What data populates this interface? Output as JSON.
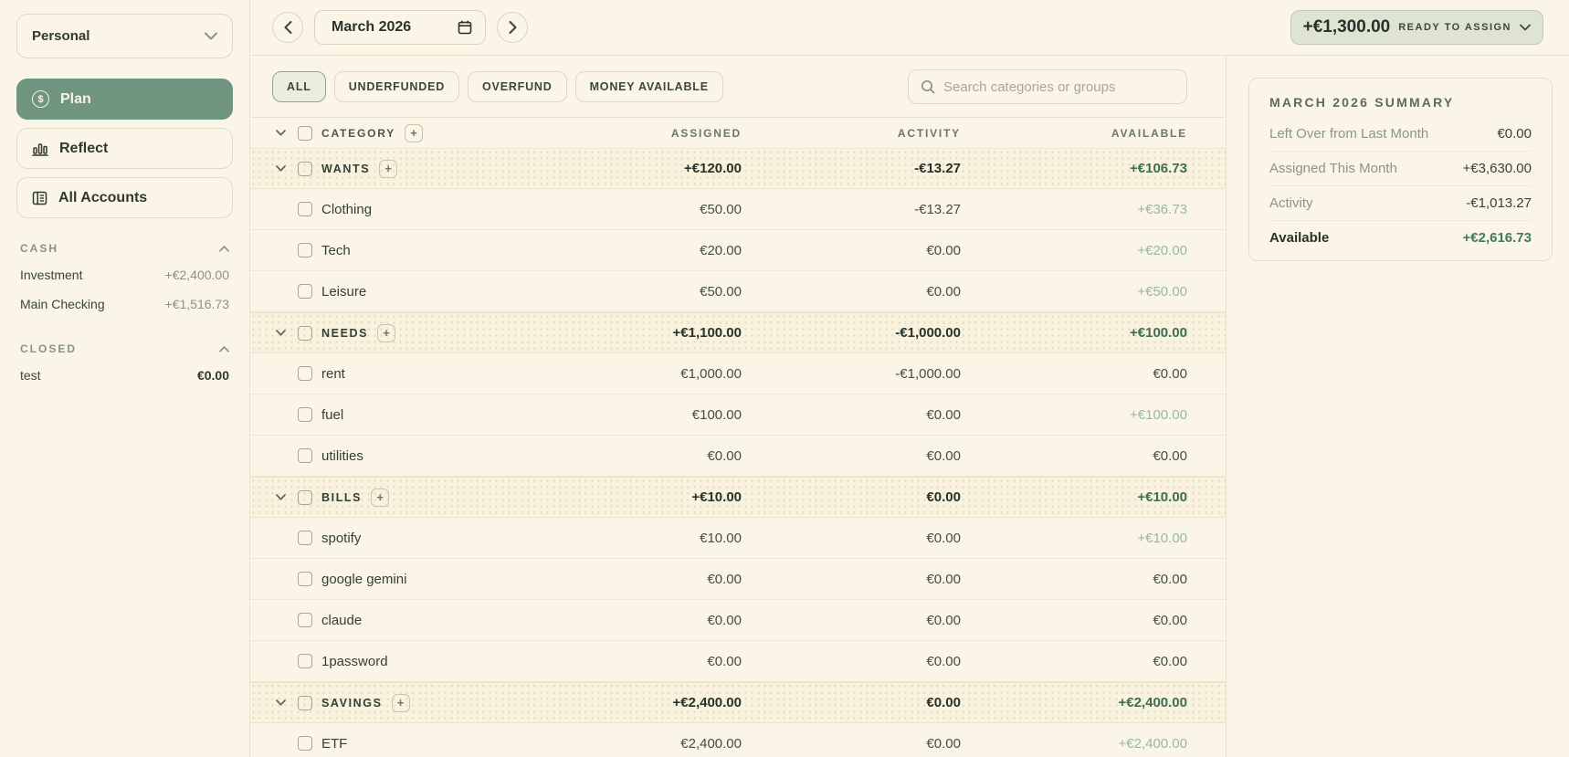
{
  "sidebar": {
    "budget_name": "Personal",
    "nav": [
      {
        "label": "Plan",
        "icon": "dollar-circle-icon",
        "active": true
      },
      {
        "label": "Reflect",
        "icon": "bar-chart-icon",
        "active": false
      },
      {
        "label": "All Accounts",
        "icon": "ledger-icon",
        "active": false
      }
    ],
    "sections": [
      {
        "title": "CASH",
        "accounts": [
          {
            "name": "Investment",
            "amount": "+€2,400.00",
            "bold": false
          },
          {
            "name": "Main Checking",
            "amount": "+€1,516.73",
            "bold": false
          }
        ]
      },
      {
        "title": "CLOSED",
        "accounts": [
          {
            "name": "test",
            "amount": "€0.00",
            "bold": true
          }
        ]
      }
    ]
  },
  "topbar": {
    "month": "March 2026",
    "ready_amount": "+€1,300.00",
    "ready_label": "READY TO ASSIGN"
  },
  "filters": {
    "active": "ALL",
    "items": [
      "ALL",
      "UNDERFUNDED",
      "OVERFUND",
      "MONEY AVAILABLE"
    ]
  },
  "search": {
    "placeholder": "Search categories or groups"
  },
  "table": {
    "header": {
      "category": "CATEGORY",
      "assigned": "ASSIGNED",
      "activity": "ACTIVITY",
      "available": "AVAILABLE"
    },
    "groups": [
      {
        "name": "WANTS",
        "assigned": "+€120.00",
        "activity": "-€13.27",
        "available": "+€106.73",
        "rows": [
          {
            "name": "Clothing",
            "assigned": "€50.00",
            "activity": "-€13.27",
            "available": "+€36.73"
          },
          {
            "name": "Tech",
            "assigned": "€20.00",
            "activity": "€0.00",
            "available": "+€20.00"
          },
          {
            "name": "Leisure",
            "assigned": "€50.00",
            "activity": "€0.00",
            "available": "+€50.00"
          }
        ]
      },
      {
        "name": "NEEDS",
        "assigned": "+€1,100.00",
        "activity": "-€1,000.00",
        "available": "+€100.00",
        "rows": [
          {
            "name": "rent",
            "assigned": "€1,000.00",
            "activity": "-€1,000.00",
            "available": "€0.00"
          },
          {
            "name": "fuel",
            "assigned": "€100.00",
            "activity": "€0.00",
            "available": "+€100.00"
          },
          {
            "name": "utilities",
            "assigned": "€0.00",
            "activity": "€0.00",
            "available": "€0.00"
          }
        ]
      },
      {
        "name": "BILLS",
        "assigned": "+€10.00",
        "activity": "€0.00",
        "available": "+€10.00",
        "rows": [
          {
            "name": "spotify",
            "assigned": "€10.00",
            "activity": "€0.00",
            "available": "+€10.00"
          },
          {
            "name": "google gemini",
            "assigned": "€0.00",
            "activity": "€0.00",
            "available": "€0.00"
          },
          {
            "name": "claude",
            "assigned": "€0.00",
            "activity": "€0.00",
            "available": "€0.00"
          },
          {
            "name": "1password",
            "assigned": "€0.00",
            "activity": "€0.00",
            "available": "€0.00"
          }
        ]
      },
      {
        "name": "SAVINGS",
        "assigned": "+€2,400.00",
        "activity": "€0.00",
        "available": "+€2,400.00",
        "rows": [
          {
            "name": "ETF",
            "assigned": "€2,400.00",
            "activity": "€0.00",
            "available": "+€2,400.00"
          }
        ]
      }
    ]
  },
  "summary": {
    "title": "MARCH 2026 SUMMARY",
    "rows": [
      {
        "label": "Left Over from Last Month",
        "value": "€0.00",
        "emphasis": false
      },
      {
        "label": "Assigned This Month",
        "value": "+€3,630.00",
        "emphasis": false
      },
      {
        "label": "Activity",
        "value": "-€1,013.27",
        "emphasis": false
      },
      {
        "label": "Available",
        "value": "+€2,616.73",
        "emphasis": true
      }
    ]
  },
  "colors": {
    "background": "#faf5e6",
    "accent_green": "#6f9580",
    "positive_bold": "#3e6e54",
    "positive_light": "#97b9a1",
    "border": "#e7e1cd",
    "ready_pill_bg": "#dee3d2"
  }
}
